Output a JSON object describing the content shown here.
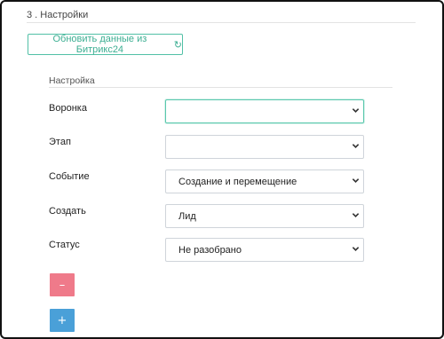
{
  "section": {
    "title": "3 . Настройки"
  },
  "refresh_button": {
    "label": "Обновить данные из Битрикс24",
    "icon": "refresh-icon"
  },
  "settings": {
    "title": "Настройка",
    "fields": [
      {
        "label": "Воронка",
        "value": ""
      },
      {
        "label": "Этап",
        "value": ""
      },
      {
        "label": "Событие",
        "value": "Создание и перемещение"
      },
      {
        "label": "Создать",
        "value": "Лид"
      },
      {
        "label": "Статус",
        "value": "Не разобрано"
      }
    ]
  },
  "buttons": {
    "remove_symbol": "–",
    "add_symbol": "+"
  },
  "colors": {
    "accent_green": "#3cae92",
    "remove_pink": "#ef7a8a",
    "add_blue": "#4aa0d8"
  }
}
